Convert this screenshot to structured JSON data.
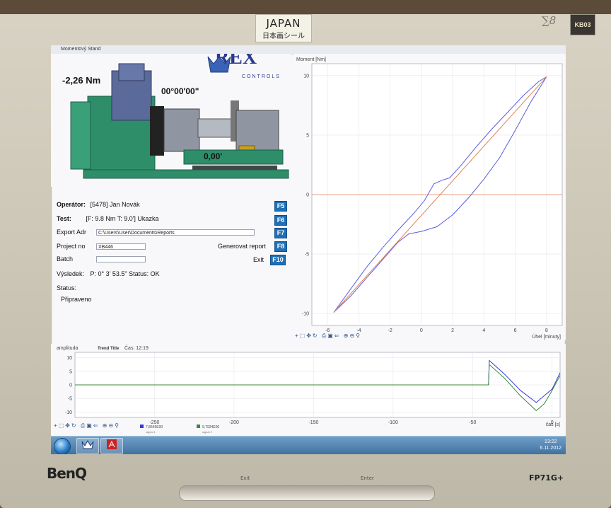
{
  "sticker": {
    "line1": "JAPAN",
    "line2": "日本画シール",
    "kb": "KB03",
    "logo_glyph": "∑8"
  },
  "window": {
    "title": "Momentový Stand"
  },
  "logo": {
    "name": "REX",
    "sub": "CONTROLS"
  },
  "overlay": {
    "torque": "-2,26 Nm",
    "angle_dms": "00°00'00\"",
    "angle_min": "0,00'"
  },
  "form": {
    "operator_label": "Operátor:",
    "operator_value": "[5478] Jan Novák",
    "f5": "F5",
    "test_label": "Test:",
    "test_value": "[F: 9.8 Nm T: 9.0'] Ukazka",
    "f6": "F6",
    "export_label": "Export Adr",
    "export_value": "C:\\Users\\User\\Documents\\Reports",
    "f7": "F7",
    "project_label": "Project no",
    "project_value": "XB446",
    "report_label": "Generovat report",
    "f8": "F8",
    "batch_label": "Batch",
    "batch_value": "",
    "exit_label": "Exit",
    "f10": "F10",
    "result_label": "Výsledek:",
    "result_value": "P: 0° 3' 53.5\" Status: OK",
    "status_label": "Status:",
    "status_value": "Připraveno"
  },
  "chart_data": [
    {
      "type": "line",
      "title": "",
      "ylabel": "Moment [Nm]",
      "xlabel": "Úhel [minuty]",
      "xlim": [
        -7,
        9
      ],
      "ylim": [
        -11,
        11
      ],
      "xticks": [
        -6,
        -4,
        -2,
        0,
        2,
        4,
        6,
        8
      ],
      "yticks": [
        -10,
        -5,
        0,
        5,
        10
      ],
      "grid": true,
      "colors": {
        "hysteresis": "#5a5fe0",
        "reference": "#e0835a"
      },
      "series": [
        {
          "x": [
            -5.6,
            -4.5,
            -3.5,
            -2.5,
            -1.5,
            -0.5,
            0.2,
            0.8,
            1.3,
            1.8,
            2.5,
            3.5,
            4.5,
            5.5,
            6.5,
            7.5,
            8.0
          ],
          "y": [
            -9.9,
            -7.9,
            -6.1,
            -4.5,
            -3.0,
            -1.6,
            -0.5,
            0.9,
            1.2,
            1.4,
            2.4,
            4.0,
            5.5,
            6.9,
            8.3,
            9.5,
            9.9
          ]
        },
        {
          "x": [
            8.0,
            7.0,
            6.0,
            5.0,
            4.0,
            3.0,
            2.0,
            1.0,
            0.0,
            -0.8,
            -1.5,
            -2.5,
            -3.5,
            -4.5,
            -5.6
          ],
          "y": [
            9.9,
            7.8,
            5.4,
            3.1,
            1.3,
            -0.3,
            -1.7,
            -2.7,
            -3.1,
            -3.3,
            -4.0,
            -5.5,
            -7.0,
            -8.5,
            -9.9
          ]
        },
        {
          "x": [
            -5.6,
            8.0
          ],
          "y": [
            -9.9,
            9.9
          ]
        }
      ]
    },
    {
      "type": "line",
      "title": "Trend Title",
      "ylabel": "amplituda",
      "xlabel": "čas [s]",
      "time_label": "Čas: 12:19",
      "xlim": [
        -300,
        5
      ],
      "ylim": [
        -12,
        12
      ],
      "xticks": [
        -250,
        -200,
        -150,
        -100,
        -50,
        0
      ],
      "yticks": [
        -10,
        -5,
        0,
        5,
        10
      ],
      "grid": true,
      "colors": {
        "signal_a": "#3a3ad8",
        "signal_b": "#3a8a3a"
      },
      "legend": [
        {
          "name": "signal 1",
          "value": "7,8545E00"
        },
        {
          "name": "signal 2",
          "value": "9,7924E00"
        }
      ],
      "series": [
        {
          "x": [
            -300,
            -40,
            -39.5,
            -30,
            -20,
            -10,
            0,
            5
          ],
          "y": [
            0,
            0,
            9.0,
            4.0,
            -2.0,
            -6.5,
            -1.5,
            4.5
          ]
        },
        {
          "x": [
            -300,
            -40,
            -39.5,
            -30,
            -20,
            -10,
            -5,
            0,
            5
          ],
          "y": [
            0,
            0,
            7.5,
            2.5,
            -4.0,
            -9.5,
            -7.0,
            -2.0,
            3.5
          ]
        }
      ]
    }
  ],
  "toolbar": {
    "icons": "+⬚✥↻ ⎙▣⇐ ⊕⊖⚲"
  },
  "taskbar": {
    "time": "13:22",
    "date": "6.11.2012"
  },
  "monitor": {
    "brand": "BenQ",
    "model": "FP71G+",
    "buttons": [
      "Exit",
      "Enter"
    ]
  }
}
